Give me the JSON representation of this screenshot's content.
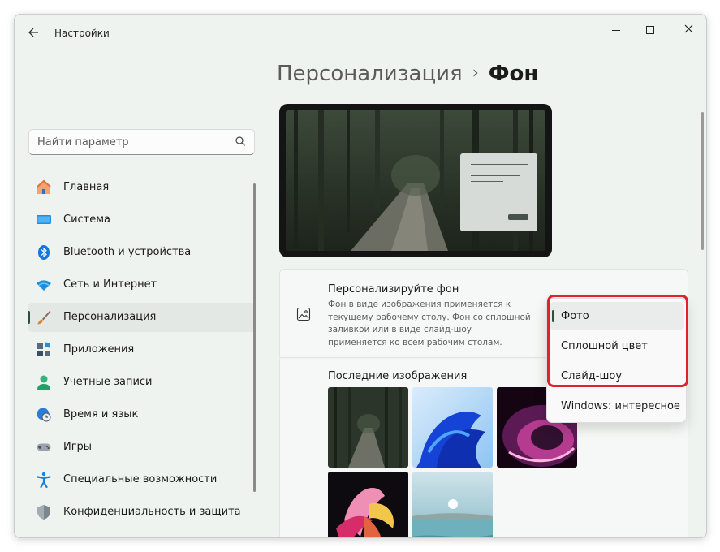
{
  "app": {
    "title": "Настройки",
    "back_icon": "arrow-left-icon"
  },
  "window_controls": {
    "minimize": "minimize-icon",
    "maximize": "maximize-icon",
    "close": "close-icon"
  },
  "search": {
    "placeholder": "Найти параметр",
    "icon": "search-icon"
  },
  "sidebar": {
    "items": [
      {
        "label": "Главная",
        "icon": "home-icon",
        "active": false
      },
      {
        "label": "Система",
        "icon": "system-icon",
        "active": false
      },
      {
        "label": "Bluetooth и устройства",
        "icon": "bluetooth-icon",
        "active": false
      },
      {
        "label": "Сеть и Интернет",
        "icon": "wifi-icon",
        "active": false
      },
      {
        "label": "Персонализация",
        "icon": "brush-icon",
        "active": true
      },
      {
        "label": "Приложения",
        "icon": "apps-icon",
        "active": false
      },
      {
        "label": "Учетные записи",
        "icon": "account-icon",
        "active": false
      },
      {
        "label": "Время и язык",
        "icon": "clock-globe-icon",
        "active": false
      },
      {
        "label": "Игры",
        "icon": "gamepad-icon",
        "active": false
      },
      {
        "label": "Специальные возможности",
        "icon": "accessibility-icon",
        "active": false
      },
      {
        "label": "Конфиденциальность и защита",
        "icon": "shield-icon",
        "active": false
      }
    ]
  },
  "header": {
    "parent": "Персонализация",
    "separator": "›",
    "current": "Фон"
  },
  "background_card": {
    "title": "Персонализируйте фон",
    "description": "Фон в виде изображения применяется к текущему рабочему столу. Фон со сплошной заливкой или в виде слайд-шоу применяется ко всем рабочим столам.",
    "icon": "image-icon"
  },
  "recent": {
    "title": "Последние изображения"
  },
  "dropdown": {
    "options": [
      "Фото",
      "Сплошной цвет",
      "Слайд-шоу",
      "Windows: интересное"
    ],
    "selected": "Фото"
  },
  "colors": {
    "accent": "#2b4f44",
    "highlight": "#e0222a"
  }
}
